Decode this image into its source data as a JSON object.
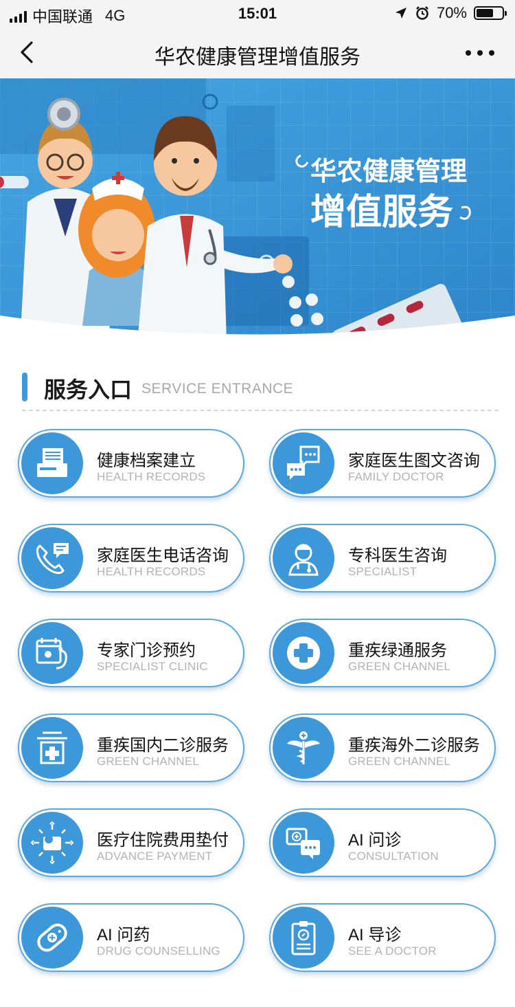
{
  "status_bar": {
    "carrier": "中国联通",
    "network": "4G",
    "time": "15:01",
    "battery_percent": "70%",
    "battery_level": 0.7
  },
  "nav": {
    "title": "华农健康管理增值服务",
    "back_icon": "chevron-left-icon",
    "more_icon": "more-dots-icon"
  },
  "banner": {
    "line1": "华农健康管理",
    "line2": "增值服务"
  },
  "section": {
    "title": "服务入口",
    "subtitle": "SERVICE ENTRANCE"
  },
  "services": [
    {
      "label": "健康档案建立",
      "sublabel": "HEALTH RECORDS",
      "icon": "health-records-icon"
    },
    {
      "label": "家庭医生图文咨询",
      "sublabel": "FAMILY DOCTOR",
      "icon": "chat-bubbles-icon"
    },
    {
      "label": "家庭医生电话咨询",
      "sublabel": "HEALTH RECORDS",
      "icon": "phone-chat-icon"
    },
    {
      "label": "专科医生咨询",
      "sublabel": "SPECIALIST",
      "icon": "doctor-avatar-icon"
    },
    {
      "label": "专家门诊预约",
      "sublabel": "SPECIALIST CLINIC",
      "icon": "calendar-stethoscope-icon"
    },
    {
      "label": "重疾绿通服务",
      "sublabel": "GREEN CHANNEL",
      "icon": "medical-cross-icon"
    },
    {
      "label": "重疾国内二诊服务",
      "sublabel": "GREEN CHANNEL",
      "icon": "hospital-box-icon"
    },
    {
      "label": "重疾海外二诊服务",
      "sublabel": "GREEN CHANNEL",
      "icon": "caduceus-icon"
    },
    {
      "label": "医疗住院费用垫付",
      "sublabel": "ADVANCE PAYMENT",
      "icon": "wallet-payment-icon"
    },
    {
      "label": "AI 问诊",
      "sublabel": "CONSULTATION",
      "icon": "ai-consult-chat-icon"
    },
    {
      "label": "AI 问药",
      "sublabel": "DRUG COUNSELLING",
      "icon": "pill-icon"
    },
    {
      "label": "AI 导诊",
      "sublabel": "SEE A DOCTOR",
      "icon": "clipboard-icon"
    }
  ],
  "colors": {
    "accent": "#3d98d9",
    "card_border": "#5aa8e0",
    "banner_bg": "#3a95d6",
    "sublabel": "#b3b3b3"
  }
}
